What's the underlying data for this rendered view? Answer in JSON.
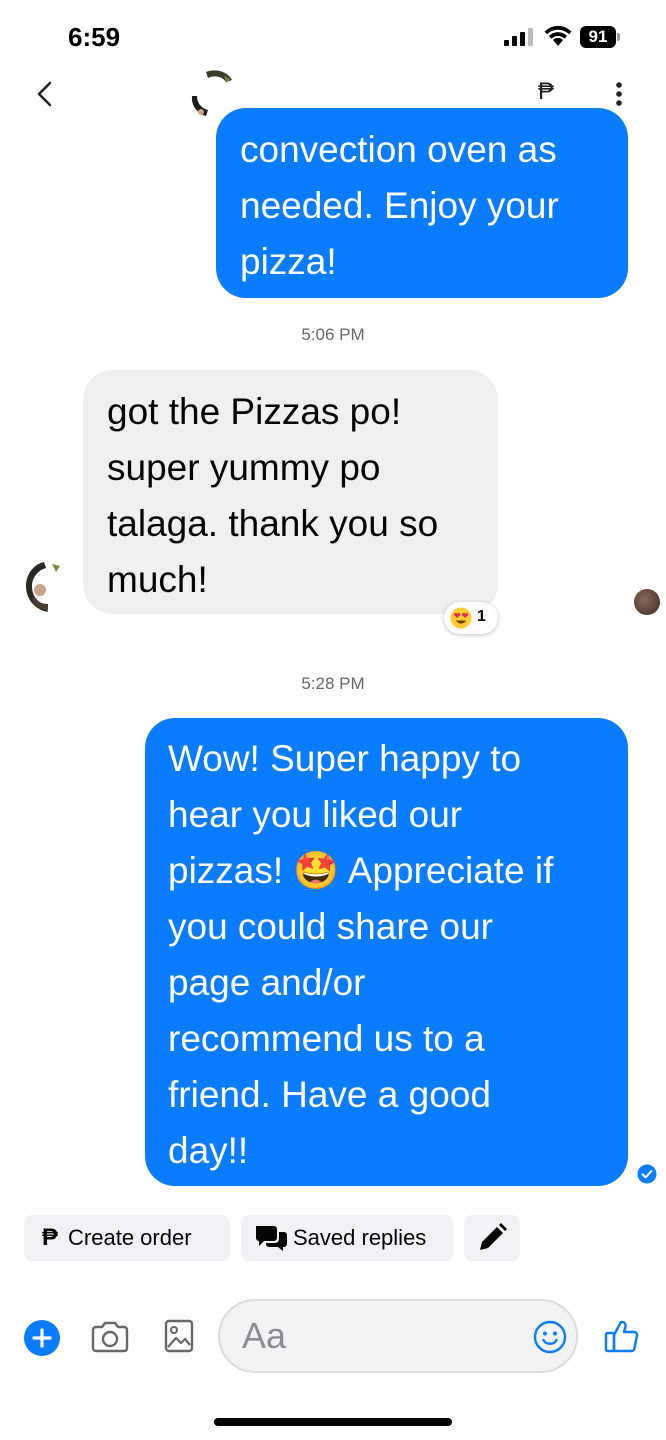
{
  "status_bar": {
    "time": "6:59",
    "battery": "91"
  },
  "header": {
    "peso_symbol": "₱"
  },
  "messages": [
    {
      "id": "msg1",
      "direction": "outgoing",
      "lines": [
        "convection oven as",
        "needed. Enjoy your",
        "pizza!"
      ]
    },
    {
      "id": "msg2",
      "direction": "incoming",
      "lines": [
        "got the Pizzas po!",
        "super yummy po",
        "talaga. thank you so",
        "much!"
      ],
      "reaction": {
        "count": "1"
      }
    },
    {
      "id": "msg3",
      "direction": "outgoing",
      "lines": [
        "Wow! Super happy to",
        "hear you liked our",
        "pizzas! 🤩 Appreciate if",
        "you could share our",
        "page and/or",
        "recommend us to a",
        "friend. Have a good",
        "day!!"
      ]
    }
  ],
  "timestamps": [
    "5:06 PM",
    "5:28 PM"
  ],
  "quick_actions": {
    "create_order": "Create order",
    "saved_replies": "Saved replies",
    "peso_symbol": "₱"
  },
  "composer": {
    "placeholder": "Aa"
  },
  "colors": {
    "outgoing_bubble": "#0a7cff",
    "incoming_bubble": "#f0f0f0",
    "accent": "#0a7cff"
  }
}
